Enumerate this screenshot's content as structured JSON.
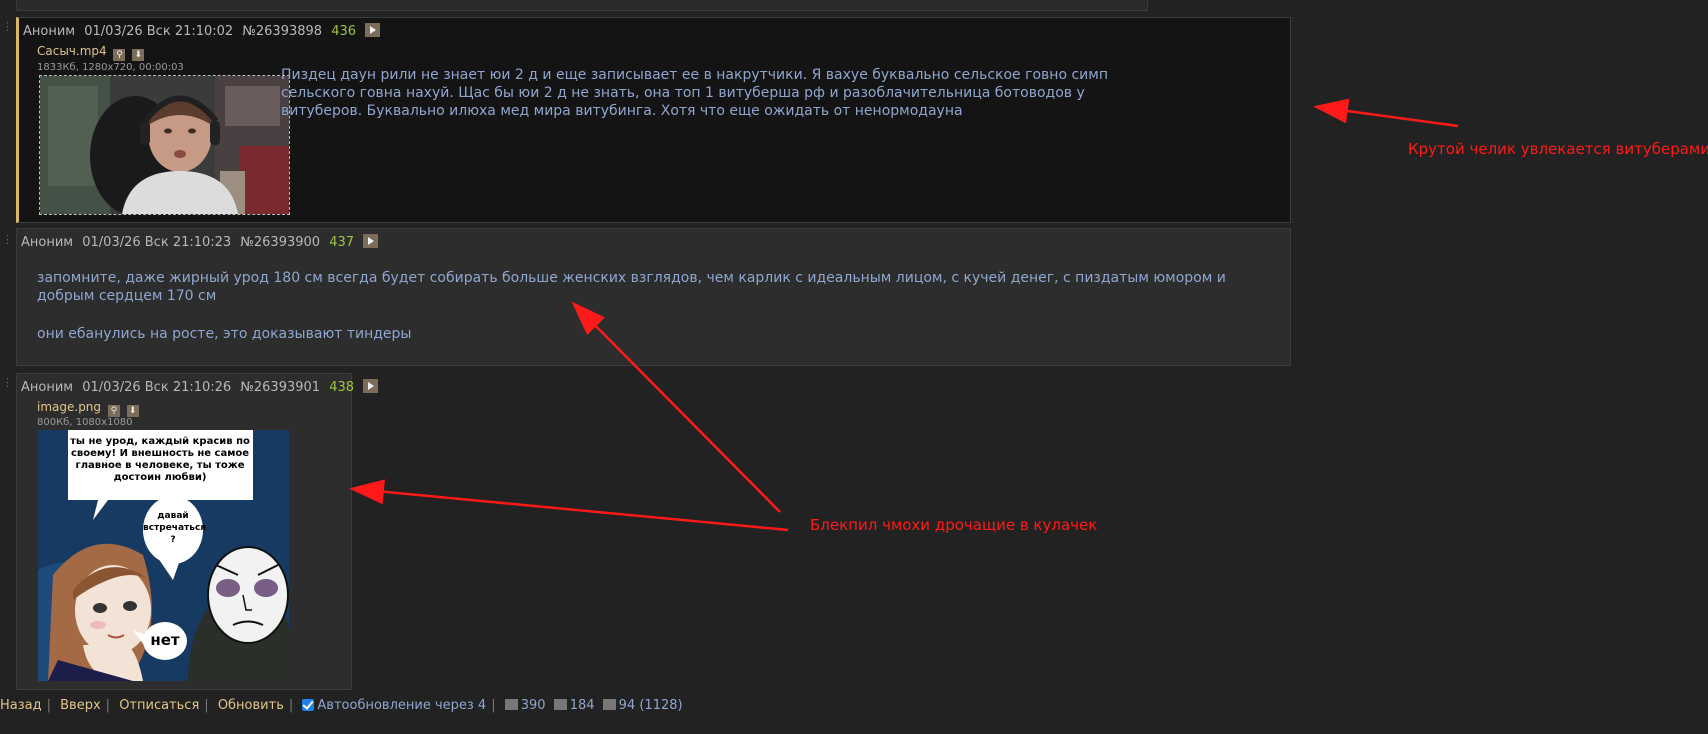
{
  "posts": [
    {
      "author": "Аноним",
      "date": "01/03/26 Вск 21:10:02",
      "number": "№26393898",
      "replies": "436",
      "file": {
        "name": "Сасыч.mp4",
        "meta": "1833Кб, 1280x720, 00:00:03"
      },
      "text": "Пиздец даун рили не знает юи 2 д и еще записывает ее в накрутчики. Я вахуе буквально сельское говно симп сельского говна нахуй. Щас бы юи 2 д не знать, она топ 1 витуберша рф и разоблачительница ботоводов у витуберов. Буквально илюха мед мира витубинга. Хотя что еще ожидать от ненормодауна"
    },
    {
      "author": "Аноним",
      "date": "01/03/26 Вск 21:10:23",
      "number": "№26393900",
      "replies": "437",
      "text_p1": "запомните, даже жирный урод 180 см всегда будет собирать больше женских взглядов, чем карлик с идеальным лицом, с кучей денег, с пиздатым юмором и добрым сердцем 170 см",
      "text_p2": "они ебанулись на росте, это доказывают тиндеры"
    },
    {
      "author": "Аноним",
      "date": "01/03/26 Вск 21:10:26",
      "number": "№26393901",
      "replies": "438",
      "file": {
        "name": "image.png",
        "meta": "800Кб, 1080x1080"
      },
      "comic": {
        "bubble_main": "ты не урод, каждый красив по своему! И внешность не самое главное в человеке, ты тоже достоин любви)",
        "bubble_ask": "давай встречаться ?",
        "bubble_no": "нет"
      }
    }
  ],
  "footer": {
    "back": "Назад",
    "up": "Вверх",
    "unsubscribe": "Отписаться",
    "refresh": "Обновить",
    "autorefresh": "Автообновление через 4",
    "posts_count": "390",
    "images_count": "184",
    "posters_count": "94 (1128)"
  },
  "annotations": {
    "a1": "Крутой челик увлекается витуберами",
    "a2": "Блекпил чмохи дрочащие в кулачек"
  },
  "colors": {
    "background": "#222222",
    "post_bg": "#2d2d2d",
    "highlight_bg": "#141414",
    "highlight_border": "#d8b866",
    "text_blue": "#8fa6cf",
    "reply_green": "#9bc441",
    "link_gold": "#e1c588",
    "annotation_red": "#ff1a1a"
  }
}
